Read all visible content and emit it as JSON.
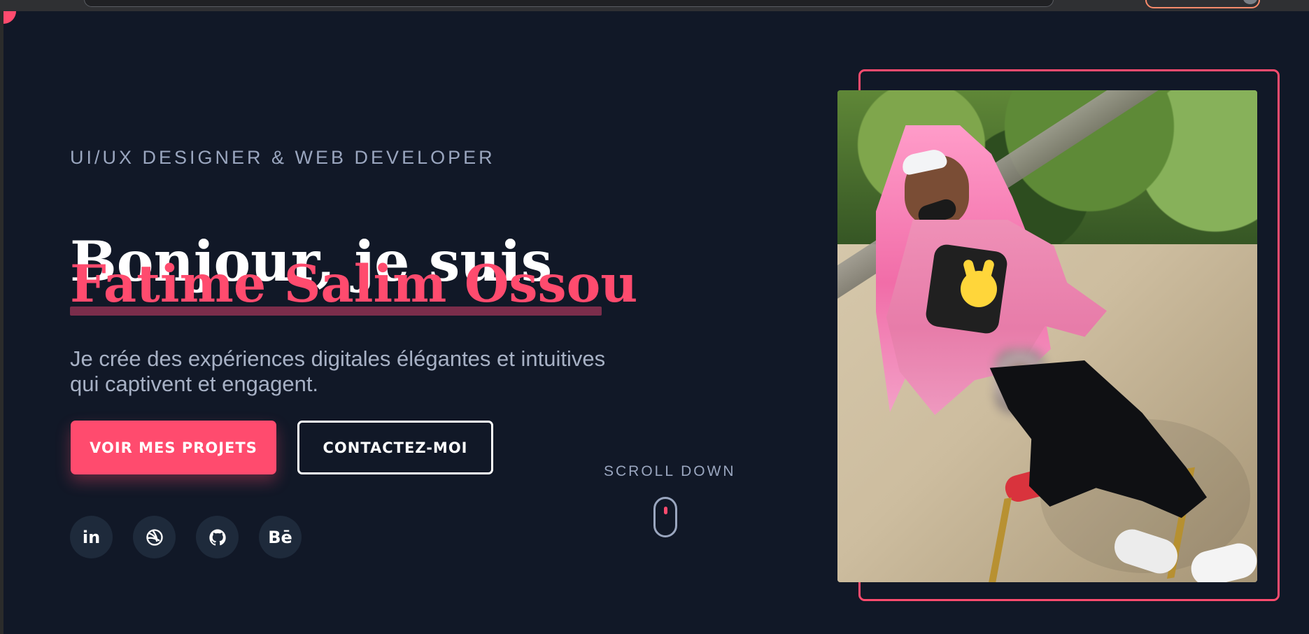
{
  "hero": {
    "role": "UI/UX DESIGNER & WEB DEVELOPER",
    "greeting": "Bonjour, je suis",
    "name": "Fatime Salim Ossou",
    "intro_line_1": "Je crée des expériences digitales élégantes et intuitives",
    "intro_line_2": "qui captivent et engagent.",
    "primary_button": "VOIR MES PROJETS",
    "secondary_button": "CONTACTEZ-MOI",
    "scroll_label": "SCROLL DOWN",
    "social": [
      {
        "label": "in",
        "icon": "linkedin-icon"
      },
      {
        "label": "",
        "icon": "dribbble-icon"
      },
      {
        "label": "",
        "icon": "github-icon"
      },
      {
        "label": "Bē",
        "icon": "behance-icon"
      }
    ]
  },
  "colors": {
    "background": "#111827",
    "accent": "#ff4b6e",
    "text_muted": "#9aa6bf",
    "button_text": "#ffffff"
  }
}
